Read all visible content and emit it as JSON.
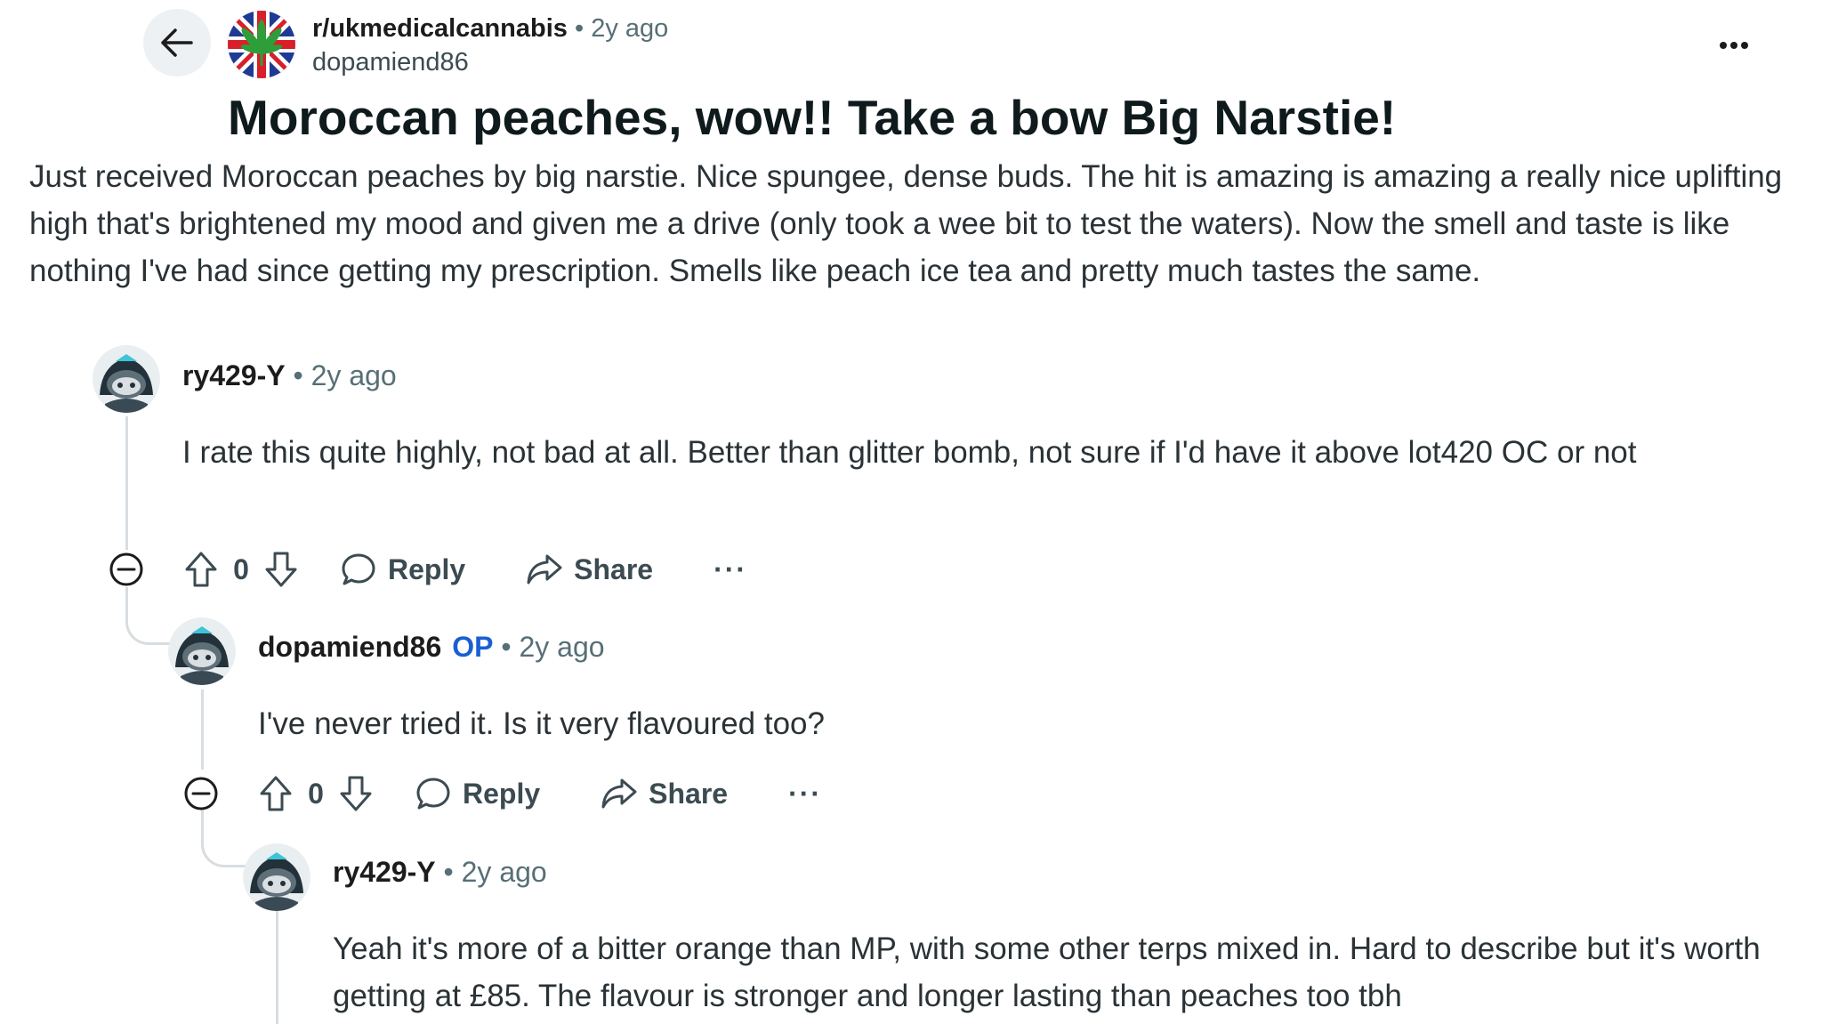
{
  "header": {
    "subreddit": "r/ukmedicalcannabis",
    "separator": "•",
    "time": "2y ago",
    "author": "dopamiend86"
  },
  "post": {
    "title": "Moroccan peaches, wow!! Take a bow Big Narstie!",
    "body": "Just received Moroccan peaches by big narstie. Nice spungee, dense buds. The hit is amazing is amazing a really nice uplifting high that's brightened my mood and given me a drive (only took a wee bit to test the waters). Now the smell and taste is like nothing I've had since getting my prescription. Smells like peach ice tea and pretty much tastes the same."
  },
  "comments": [
    {
      "user": "ry429-Y",
      "separator": "•",
      "time": "2y ago",
      "body": "I rate this quite highly, not bad at all. Better than glitter bomb, not sure if I'd have it above lot420 OC or not",
      "votes": "0",
      "reply_label": "Reply",
      "share_label": "Share",
      "more_label": "···"
    },
    {
      "user": "dopamiend86",
      "op_badge": "OP",
      "separator": "•",
      "time": "2y ago",
      "body": "I've never tried it. Is it very flavoured too?",
      "votes": "0",
      "reply_label": "Reply",
      "share_label": "Share",
      "more_label": "···"
    },
    {
      "user": "ry429-Y",
      "separator": "•",
      "time": "2y ago",
      "body": "Yeah it's more of a bitter orange than MP, with some other terps mixed in. Hard to describe but it's worth getting at £85. The flavour is stronger and longer lasting than peaches too tbh"
    }
  ],
  "colors": {
    "op_badge": "#1a5fd1",
    "meta_text": "#576f76",
    "thread_line": "#d7dde0",
    "back_button_bg": "#eef1f3"
  },
  "icons": [
    "back-arrow-icon",
    "subreddit-icon",
    "more-horizontal-icon",
    "collapse-icon",
    "upvote-icon",
    "downvote-icon",
    "reply-bubble-icon",
    "share-arrow-icon",
    "snoo-avatar-icon"
  ]
}
